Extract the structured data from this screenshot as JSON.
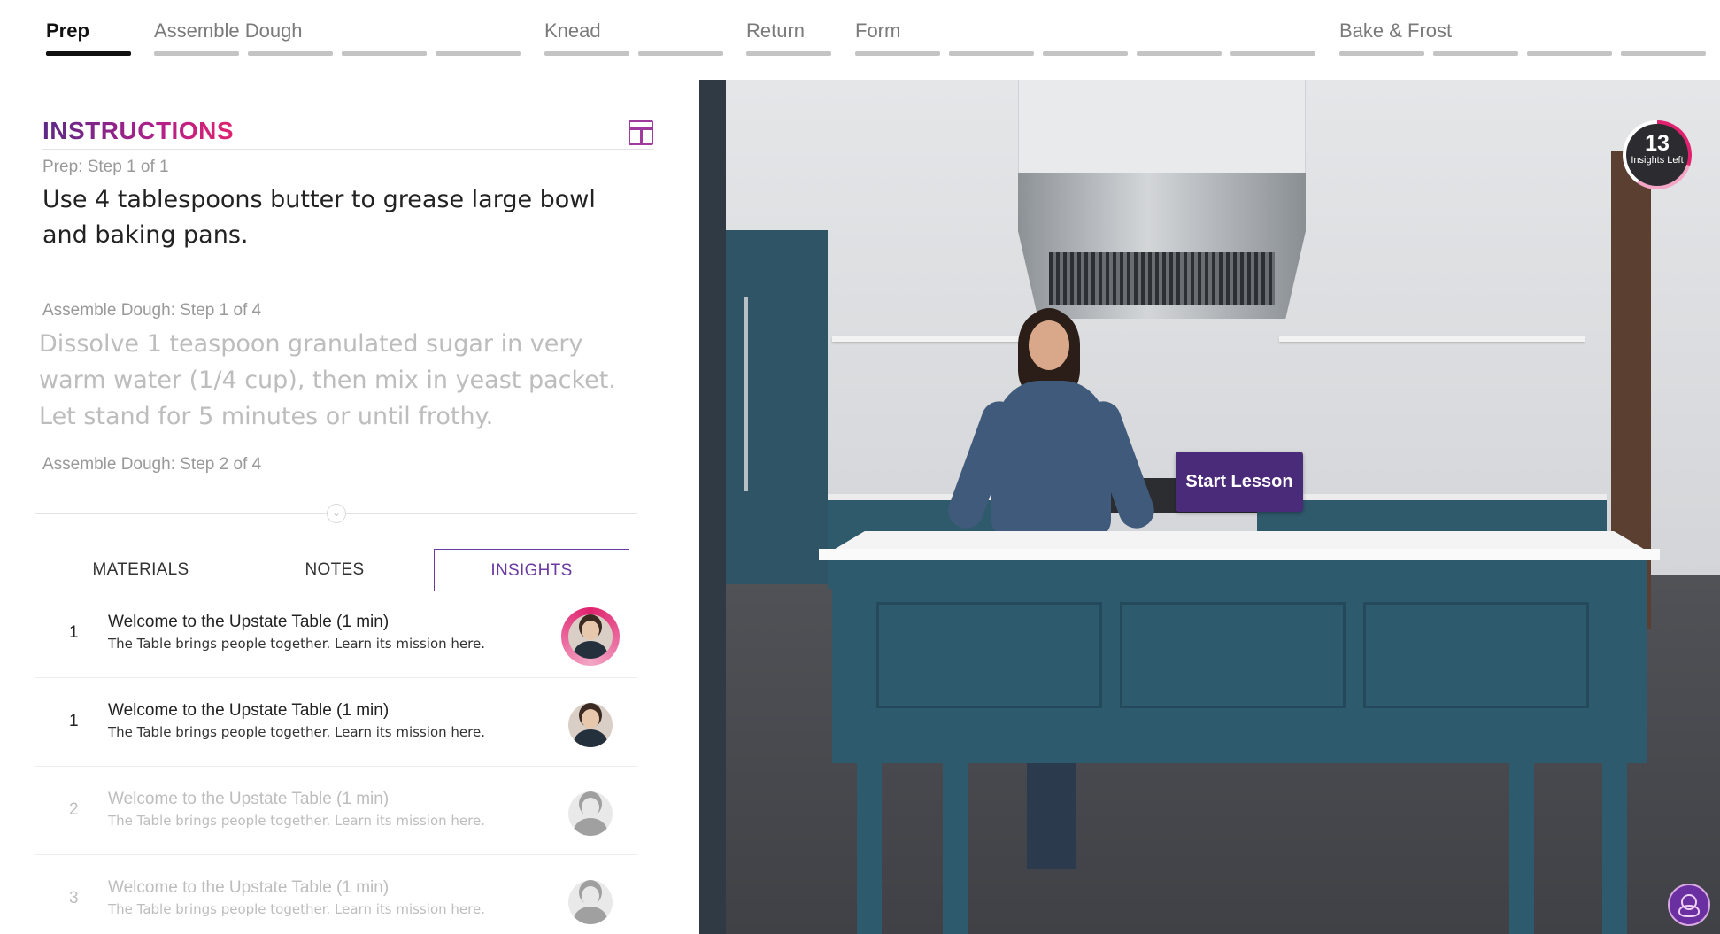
{
  "stages": [
    {
      "label": "Prep",
      "active": true
    },
    {
      "label": "Assemble Dough",
      "active": false
    },
    {
      "label": "Knead",
      "active": false
    },
    {
      "label": "Return",
      "active": false
    },
    {
      "label": "Form",
      "active": false
    },
    {
      "label": "Bake & Frost",
      "active": false
    }
  ],
  "instructions": {
    "title": "INSTRUCTIONS",
    "panel_icon": "layout-panel-icon",
    "steps": [
      {
        "label": "Prep: Step 1 of 1",
        "text": "Use 4 tablespoons butter to grease large bowl and baking pans."
      },
      {
        "label": "Assemble Dough: Step 1 of 4",
        "text": "Dissolve 1 teaspoon granulated sugar in very warm water (1/4 cup), then mix in yeast packet. Let stand for 5 minutes or until frothy."
      },
      {
        "label": "Assemble Dough: Step 2 of 4",
        "text": ""
      }
    ]
  },
  "tabs": [
    {
      "label": "MATERIALS",
      "active": false
    },
    {
      "label": "NOTES",
      "active": false
    },
    {
      "label": "INSIGHTS",
      "active": true
    }
  ],
  "insights": [
    {
      "num": "1",
      "title": "Welcome to the Upstate Table (1 min)",
      "subtitle": "The Table brings people together. Learn its mission here.",
      "state": "current"
    },
    {
      "num": "1",
      "title": "Welcome to the Upstate Table (1 min)",
      "subtitle": "The Table brings people together. Learn its mission here.",
      "state": "normal"
    },
    {
      "num": "2",
      "title": "Welcome to the Upstate Table (1 min)",
      "subtitle": "The Table brings people together. Learn its mission here.",
      "state": "faded"
    },
    {
      "num": "3",
      "title": "Welcome to the Upstate Table (1 min)",
      "subtitle": "The Table brings people together. Learn its mission here.",
      "state": "faded"
    }
  ],
  "video": {
    "start_label": "Start Lesson",
    "insights_left_count": "13",
    "insights_left_label": "Insights Left"
  },
  "colors": {
    "accent": "#6a3aa0",
    "brand_gradient_start": "#5b2a86",
    "brand_gradient_end": "#e0226e",
    "start_button": "#4a2b7a"
  }
}
